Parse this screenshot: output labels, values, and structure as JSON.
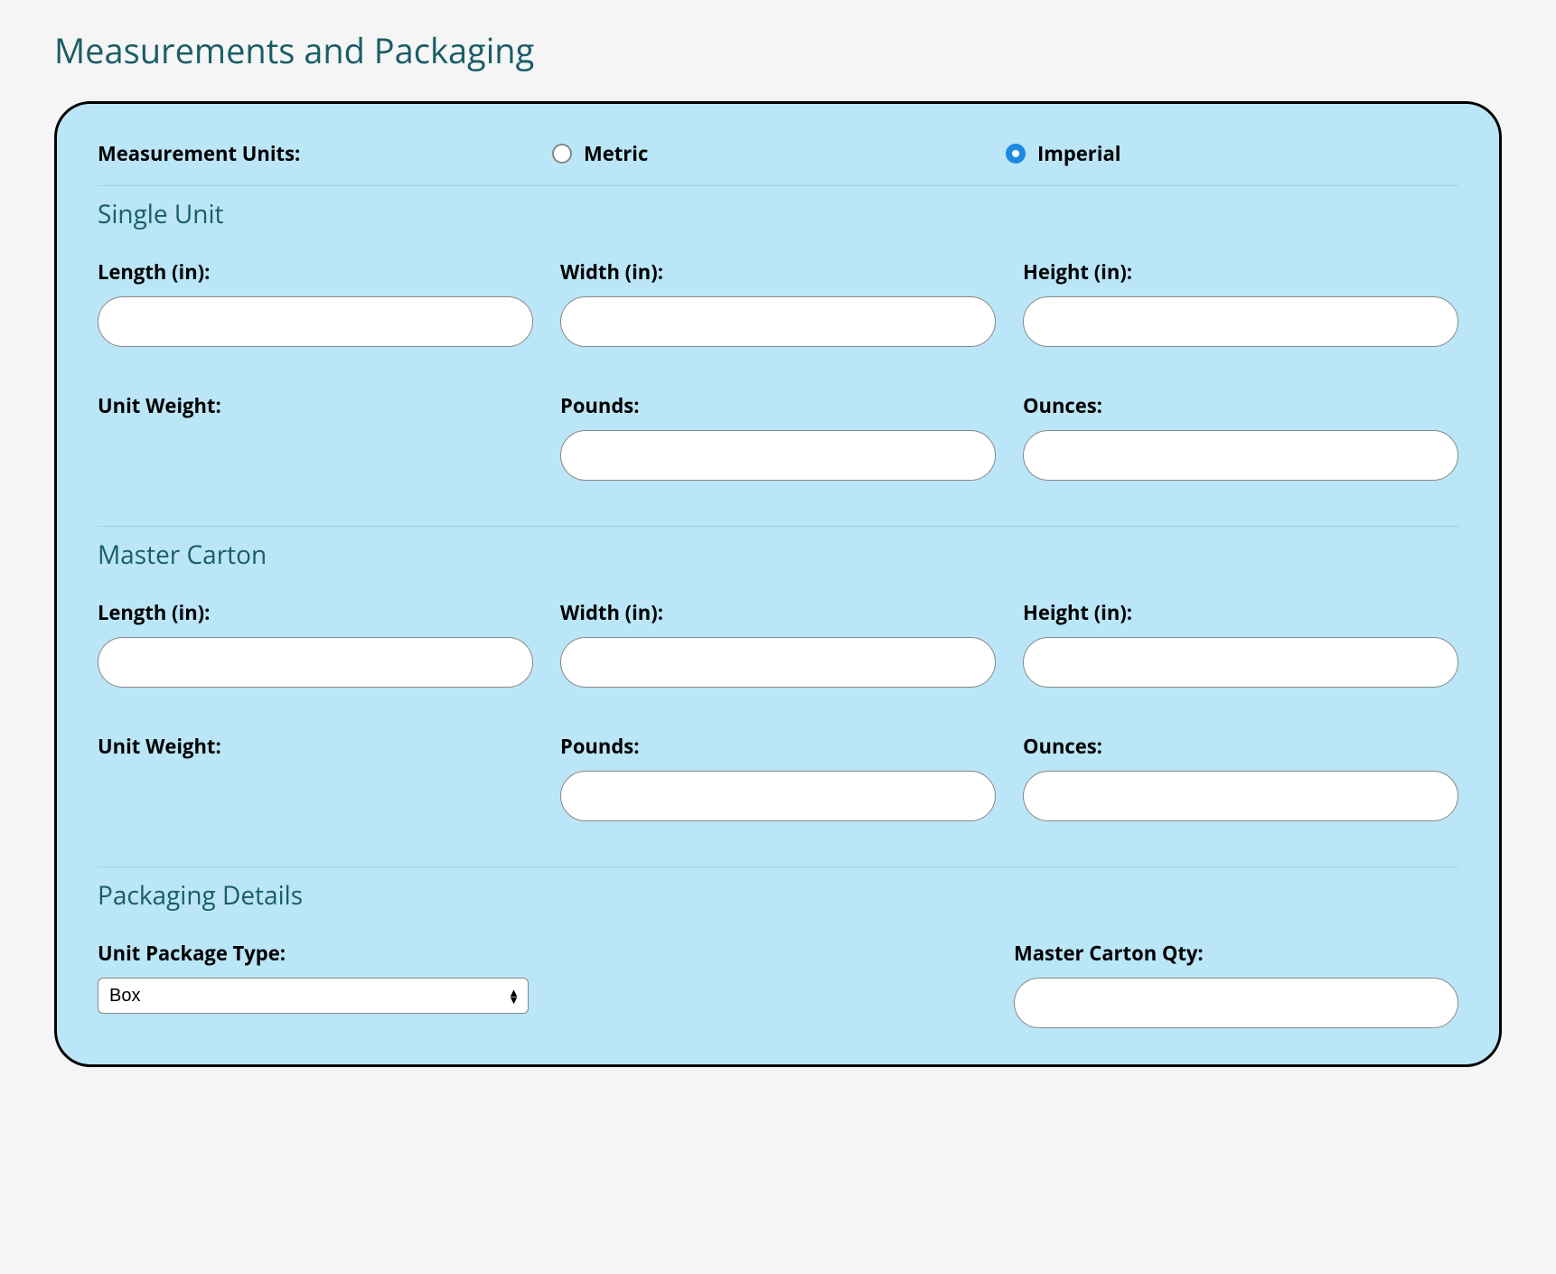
{
  "pageTitle": "Measurements and Packaging",
  "units": {
    "label": "Measurement Units:",
    "metric": "Metric",
    "imperial": "Imperial",
    "selected": "imperial"
  },
  "singleUnit": {
    "header": "Single Unit",
    "length": {
      "label": "Length (in):",
      "value": ""
    },
    "width": {
      "label": "Width (in):",
      "value": ""
    },
    "height": {
      "label": "Height (in):",
      "value": ""
    },
    "unitWeightLabel": "Unit Weight:",
    "pounds": {
      "label": "Pounds:",
      "value": ""
    },
    "ounces": {
      "label": "Ounces:",
      "value": ""
    }
  },
  "masterCarton": {
    "header": "Master Carton",
    "length": {
      "label": "Length (in):",
      "value": ""
    },
    "width": {
      "label": "Width (in):",
      "value": ""
    },
    "height": {
      "label": "Height (in):",
      "value": ""
    },
    "unitWeightLabel": "Unit Weight:",
    "pounds": {
      "label": "Pounds:",
      "value": ""
    },
    "ounces": {
      "label": "Ounces:",
      "value": ""
    }
  },
  "packaging": {
    "header": "Packaging Details",
    "unitPackageType": {
      "label": "Unit Package Type:",
      "selected": "Box"
    },
    "masterCartonQty": {
      "label": "Master Carton Qty:",
      "value": ""
    }
  }
}
